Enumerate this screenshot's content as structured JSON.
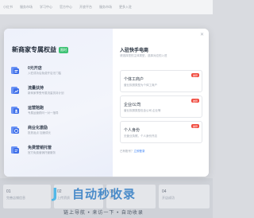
{
  "topnav": {
    "items": [
      "小红书",
      "服务市场",
      "学习中心",
      "官方中心",
      "开放平台",
      "服务市场",
      "更多入驻"
    ]
  },
  "modal": {
    "left": {
      "title": "新商家专属权益",
      "badge": "限时",
      "benefits": [
        {
          "title": "0元开店",
          "desc": "入驻成功后免费开店无门槛",
          "icon": "store-icon",
          "color": "#4a7bf0"
        },
        {
          "title": "流量扶持",
          "desc": "新商家享受专属流量扶持计划",
          "icon": "traffic-icon",
          "color": "#4a7bf0"
        },
        {
          "title": "运营陪跑",
          "desc": "专属运营顾问一对一指导",
          "icon": "coach-icon",
          "color": "#4a7bf0"
        },
        {
          "title": "商业化激励",
          "desc": "投放返点 加速成长",
          "icon": "incentive-icon",
          "color": "#4a7bf0"
        },
        {
          "title": "免费营销托管",
          "desc": "官方免费营销托管服务",
          "icon": "marketing-icon",
          "color": "#4a7bf0"
        }
      ]
    },
    "right": {
      "title": "入驻快手电商",
      "subtitle": "请选择您的主体类型，选择对应的入驻",
      "types": [
        {
          "title": "个体工商户",
          "desc": "营业执照类型为个体工商户",
          "tag": "推荐"
        },
        {
          "title": "企业/公司",
          "desc": "营业执照类型包含公司 企业等",
          "tag": "推荐"
        },
        {
          "title": "个人身份",
          "desc": "无营业执照，个人身份开店",
          "tag": "推荐"
        }
      ],
      "footer_prefix": "已有账号？",
      "footer_link": "立即登录"
    }
  },
  "background": {
    "cards": [
      {
        "label": "01",
        "text": "完善店铺信息"
      },
      {
        "label": "02",
        "text": "上传资质"
      },
      {
        "label": "03",
        "text": "审核"
      },
      {
        "label": "04",
        "text": "开店成功"
      }
    ]
  },
  "watermark": {
    "title": "自动秒收录",
    "subtitle": "链上导航 • 来访一下 • 自动收录"
  },
  "colors": {
    "accent": "#4a7bf0",
    "tag": "#f04a3e",
    "badge": "#3ec274"
  }
}
